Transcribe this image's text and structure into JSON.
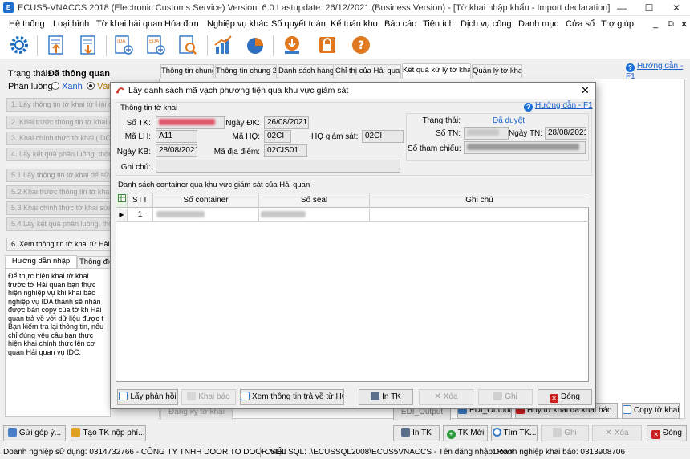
{
  "window": {
    "title": "ECUS5-VNACCS 2018 (Electronic Customs Service) Version: 6.0 Lastupdate: 26/12/2021 (Business Version) - [Tờ khai nhập khẩu - Import declaration]",
    "icon_glyph": "E"
  },
  "menu": [
    "Hệ thống",
    "Loại hình",
    "Tờ khai hải quan",
    "Hóa đơn",
    "Nghiệp vụ khác",
    "Số quyết toán",
    "Kế toán kho",
    "Báo cáo",
    "Tiện ích",
    "Dịch vụ công",
    "Danh mục",
    "Cửa sổ",
    "Trợ giúp"
  ],
  "toolbar_icons": [
    "gear-icon",
    "import-doc-icon",
    "export-doc-icon",
    "ida-add-icon",
    "eda-add-icon",
    "search-doc-icon",
    "bar-chart-icon",
    "pie-chart-icon",
    "download-icon",
    "lock-icon",
    "help-icon"
  ],
  "left": {
    "status_label": "Trạng thái:",
    "status_value": "Đã thông quan",
    "phanluong_label": "Phân luồng:",
    "radio_green": "Xanh",
    "radio_yellow": "Vàn",
    "steps": [
      "1. Lấy thông tin tờ khai từ Hải qu",
      "2. Khai trước thông tin tờ khai (ID",
      "3. Khai chính thức tờ khai (IDC)",
      "4. Lấy kết quả phân luồng, thông",
      "5.1 Lấy thông tin tờ khai để sửa",
      "5.2 Khai trước thông tin tờ khai s",
      "5.3 Khai chính thức tờ khai sửa",
      "5.4 Lấy kết quả phân luồng, thôn",
      "6. Xem thông tin tờ khai từ Hải qu"
    ],
    "tab_guide": "Hướng dẫn nhập liệu",
    "tab_info": "Thông điệ",
    "guide_text": "Để thực hiện khai tờ khai trước tờ Hải quan bạn thực hiện nghiệp vụ khi khai báo nghiệp vụ IDA thành sẽ nhận được bản copy của tờ kh Hải quan trả về với dữ liệu được t Bạn kiểm tra lại thông tin, nếu chỉ đúng yêu cầu bạn thực hiện khai chính thức lên cơ quan Hải quan vụ IDC."
  },
  "main_tabs": [
    "Thông tin chung",
    "Thông tin chung 2",
    "Danh sách hàng",
    "Chỉ thị của Hải quan",
    "Kết quả xử lý tờ khai",
    "Quản lý tờ khai"
  ],
  "main_help": "Hướng dẫn - F1",
  "dialog": {
    "title": "Lấy danh sách mã vạch phương tiện qua khu vực giám sát",
    "group_title": "Thông tin tờ khai",
    "help": "Hướng dẫn - F1",
    "fields": {
      "so_tk_label": "Số TK:",
      "ngay_dk_label": "Ngày ĐK:",
      "ngay_dk": "26/08/2021",
      "ma_lh_label": "Mã LH:",
      "ma_lh": "A11",
      "ma_hq_label": "Mã HQ:",
      "ma_hq": "02CI",
      "hq_giam_sat_label": "HQ giám sát:",
      "hq_giam_sat": "02CI",
      "ngay_kb_label": "Ngày KB:",
      "ngay_kb": "28/08/2021",
      "ma_dia_diem_label": "Mã địa điểm:",
      "ma_dia_diem": "02CIS01",
      "ghi_chu_label": "Ghi chú:",
      "trang_thai_label": "Trạng thái:",
      "trang_thai": "Đã duyệt",
      "so_tn_label": "Số TN:",
      "ngay_tn_label": "Ngày TN:",
      "ngay_tn": "28/08/2021",
      "so_tham_chieu_label": "Số tham chiếu:"
    },
    "grid_title": "Danh sách container qua khu vực giám sát của Hải quan",
    "columns": [
      "STT",
      "Số container",
      "Số seal",
      "Ghi chú"
    ],
    "rows": [
      {
        "stt": "1"
      }
    ],
    "buttons": {
      "lay_phan_hoi": "Lấy phản hồi",
      "khai_bao": "Khai báo",
      "xem_thong_tin": "Xem thông tin trả về từ HQ...",
      "in_tk": "In TK",
      "xoa": "Xóa",
      "ghi": "Ghi",
      "dong": "Đóng"
    }
  },
  "behind_buttons": {
    "huy": "Hủy tờ khai đã khai báo ...",
    "copy": "Copy tờ khai",
    "edi": "EDI_Output",
    "dang_ky": "Đăng ký tờ khai"
  },
  "bottom": {
    "gop_y": "Gửi góp ý...",
    "tao_tk": "Tạo TK nộp phí...",
    "in_tk": "In TK",
    "tk_moi": "TK Mới",
    "tim_tk": "Tìm TK...",
    "ghi": "Ghi",
    "xoa": "Xóa",
    "dong": "Đóng"
  },
  "status_bar": {
    "dn": "Doanh nghiệp sử dụng: 0314732766 - CÔNG TY TNHH DOOR TO DOOR VIỆT",
    "csdl": "CSDL SQL: .\\ECUSSQL2008\\ECUS5VNACCS - Tên đăng nhập: Root",
    "dn_kb": "Doanh nghiệp khai báo: 0313908706"
  },
  "colors": {
    "link": "#1a5fc7",
    "redacted_red": "#e05a6e",
    "close_red": "#cc1f1f",
    "accent_blue": "#1a6fd8"
  }
}
